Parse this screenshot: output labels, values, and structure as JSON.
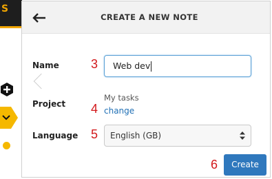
{
  "left_strip": {
    "topbar_text": "S",
    "accent_color": "#f1a600"
  },
  "modal": {
    "title": "CREATE A NEW NOTE",
    "back_icon": "back-arrow-icon",
    "fields": {
      "name": {
        "label": "Name",
        "value": "Web dev",
        "step": "3"
      },
      "project": {
        "label": "Project",
        "value": "My tasks",
        "change_label": "change",
        "step": "4"
      },
      "language": {
        "label": "Language",
        "value": "English (GB)",
        "step": "5"
      }
    },
    "create": {
      "label": "Create",
      "step": "6"
    }
  },
  "colors": {
    "primary_button": "#2f78bd",
    "link": "#1f6fb5",
    "step_number": "#d2181b",
    "input_focus": "#5aa0d6"
  }
}
